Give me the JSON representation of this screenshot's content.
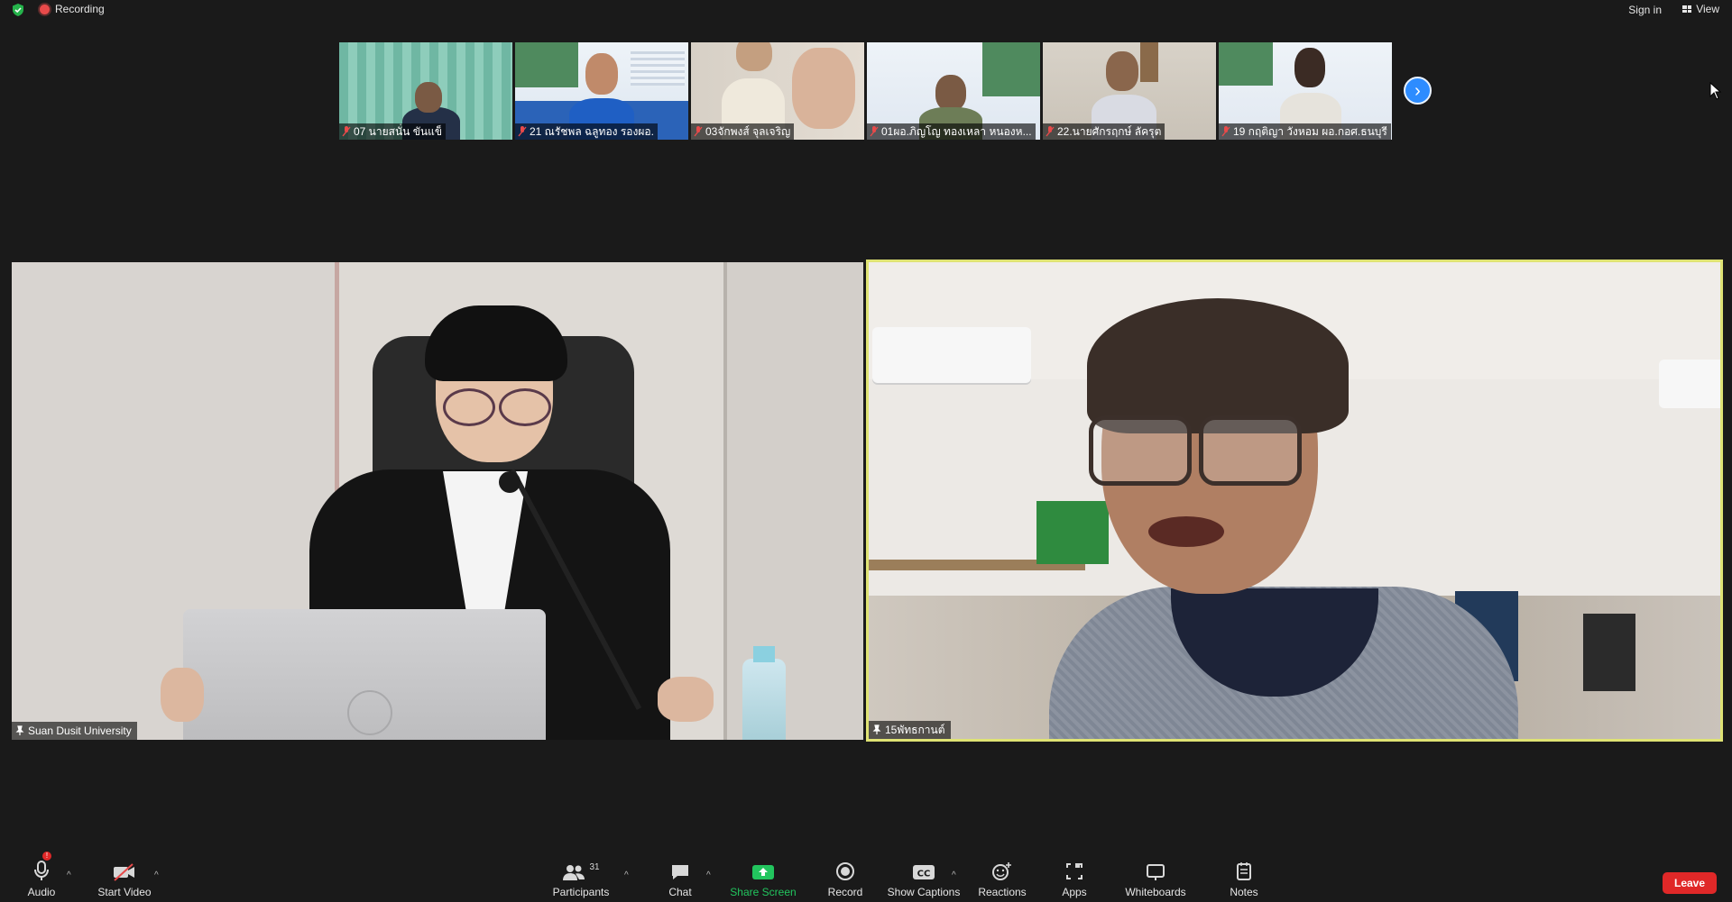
{
  "top_bar": {
    "recording_label": "Recording",
    "sign_in_label": "Sign in",
    "view_label": "View"
  },
  "thumbnails": [
    {
      "name": "07 นายสนั่น ขันแข็"
    },
    {
      "name": "21 ณรัชพล ฉลูทอง รองผอ."
    },
    {
      "name": "03จักพงส์ จุลเจริญ"
    },
    {
      "name": "01ผอ.ภิญโญ  ทองเหลา หนองห..."
    },
    {
      "name": "22.นายศักรฤกษ์ ลัครุต"
    },
    {
      "name": "19 กฤติญา วังหอม ผอ.กอศ.ธนบุรี"
    }
  ],
  "main_tiles": {
    "left": {
      "name": "Suan Dusit University"
    },
    "right": {
      "name": "15พัทธกานต์"
    }
  },
  "toolbar": {
    "audio": {
      "label": "Audio",
      "icon": "microphone-icon"
    },
    "video": {
      "label": "Start Video",
      "icon": "video-off-icon"
    },
    "participants": {
      "label": "Participants",
      "count": "31",
      "icon": "participants-icon"
    },
    "chat": {
      "label": "Chat",
      "icon": "chat-icon"
    },
    "share": {
      "label": "Share Screen",
      "icon": "share-screen-icon"
    },
    "record": {
      "label": "Record",
      "icon": "record-icon"
    },
    "captions": {
      "label": "Show Captions",
      "icon": "cc-icon"
    },
    "reactions": {
      "label": "Reactions",
      "icon": "reaction-icon"
    },
    "apps": {
      "label": "Apps",
      "icon": "apps-icon"
    },
    "whiteboards": {
      "label": "Whiteboards",
      "icon": "whiteboard-icon"
    },
    "notes": {
      "label": "Notes",
      "icon": "notes-icon"
    },
    "leave": {
      "label": "Leave"
    }
  },
  "colors": {
    "background": "#1a1a1a",
    "active_speaker_border": "#dfe374",
    "share_green": "#22c55e",
    "leave_red": "#e02828",
    "accent_blue": "#2d8cff"
  }
}
